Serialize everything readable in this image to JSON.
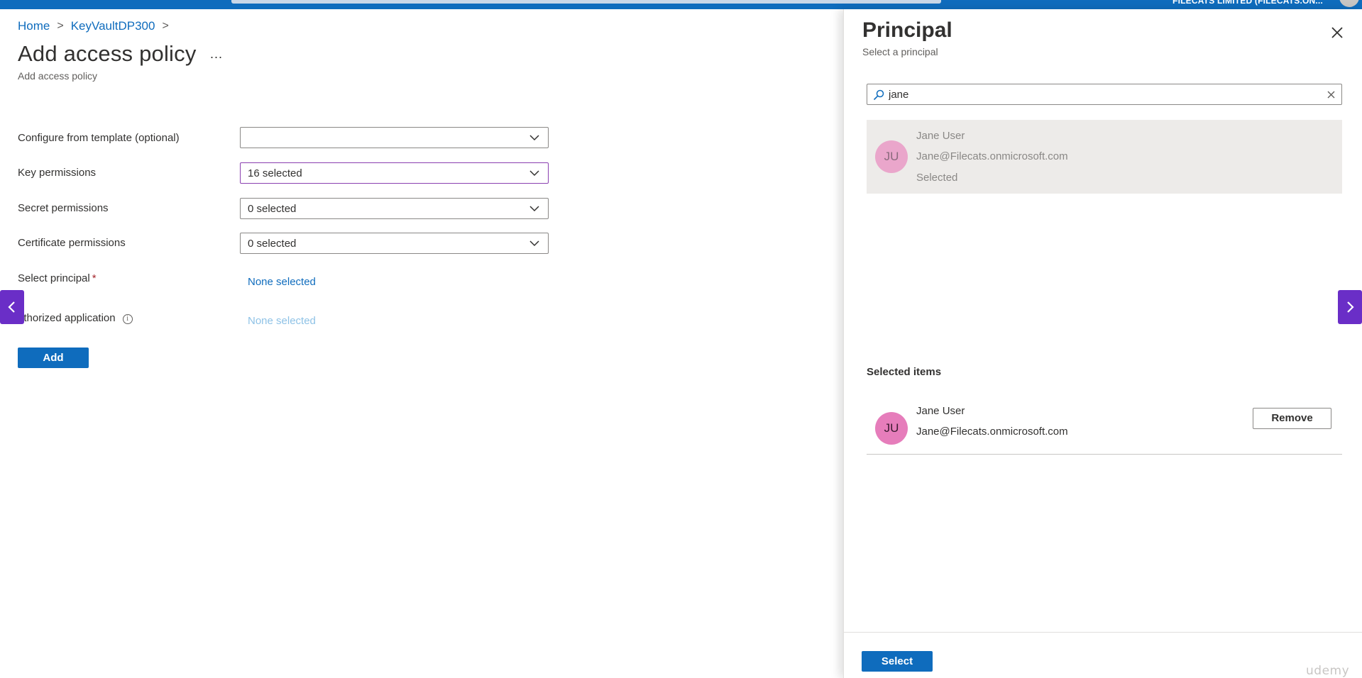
{
  "topbar": {
    "account": "FILECATS LIMITED (FILECATS.ON..."
  },
  "breadcrumb": {
    "items": [
      "Home",
      "KeyVaultDP300"
    ],
    "separator": ">"
  },
  "page": {
    "title": "Add access policy",
    "more": "...",
    "subtitle": "Add access policy"
  },
  "form": {
    "template": {
      "label": "Configure from template (optional)",
      "value": ""
    },
    "key_permissions": {
      "label": "Key permissions",
      "value": "16 selected"
    },
    "secret_permissions": {
      "label": "Secret permissions",
      "value": "0 selected"
    },
    "certificate_permissions": {
      "label": "Certificate permissions",
      "value": "0 selected"
    },
    "principal": {
      "label": "Select principal",
      "required_mark": "*",
      "value": "None selected"
    },
    "authorized_application": {
      "label": "uthorized application",
      "info": "i",
      "value": "None selected"
    },
    "add_label": "Add"
  },
  "panel": {
    "title": "Principal",
    "subtitle": "Select a principal",
    "search": {
      "value": "jane",
      "placeholder": ""
    },
    "results": [
      {
        "initials": "JU",
        "name": "Jane User",
        "email": "Jane@Filecats.onmicrosoft.com",
        "status": "Selected"
      }
    ],
    "selected_heading": "Selected items",
    "selected_items": [
      {
        "initials": "JU",
        "name": "Jane User",
        "email": "Jane@Filecats.onmicrosoft.com",
        "remove_label": "Remove"
      }
    ],
    "select_label": "Select"
  },
  "watermark": "udemy",
  "colors": {
    "accent": "#0f6cbd",
    "nav_arrow": "#6a2ec7",
    "avatar": "#e67dbb",
    "focus_border": "#8a3fb0",
    "required": "#a4262c"
  },
  "icons": [
    "chevron-down-icon",
    "close-icon",
    "search-icon",
    "clear-icon",
    "info-icon",
    "chevron-left-icon",
    "chevron-right-icon"
  ]
}
